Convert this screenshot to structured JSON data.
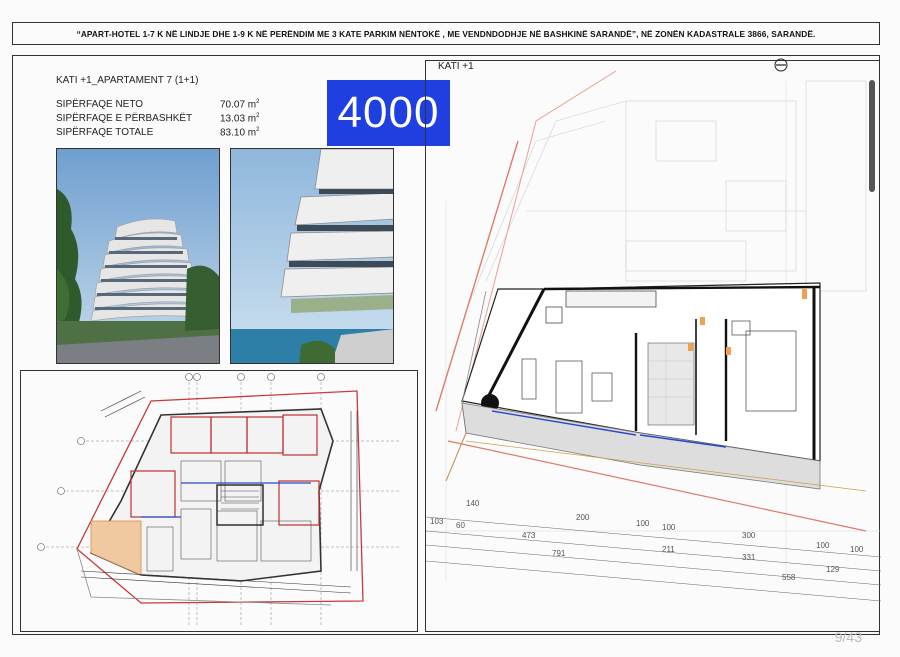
{
  "header": {
    "title": "“APART-HOTEL 1-7 K NË LINDJE DHE 1-9 K NË PERËNDIM ME 3 KATE PARKIM NËNTOKË , ME VENDNDODHJE NË BASHKINË SARANDË”, NË ZONËN KADASTRALE 3866, SARANDË."
  },
  "apartment": {
    "title": "KATI  +1_APARTAMENT 7   (1+1)",
    "rows": [
      {
        "label": "SIPËRFAQE NETO",
        "value": "70.07 m",
        "sup": "2"
      },
      {
        "label": "SIPËRFAQE E PËRBASHKËT",
        "value": "13.03 m",
        "sup": "2"
      },
      {
        "label": "SIPËRFAQE TOTALE",
        "value": "83.10 m",
        "sup": "2"
      }
    ]
  },
  "badge": {
    "text": "4000",
    "color": "#1f3fe0"
  },
  "floor_plan": {
    "title": "KATI  +1",
    "dimensions": [
      "140",
      "200",
      "100",
      "100",
      "300",
      "100",
      "100",
      "103",
      "60",
      "473",
      "211",
      "331",
      "791",
      "558",
      "129"
    ]
  },
  "footer": {
    "page": "9/43"
  }
}
